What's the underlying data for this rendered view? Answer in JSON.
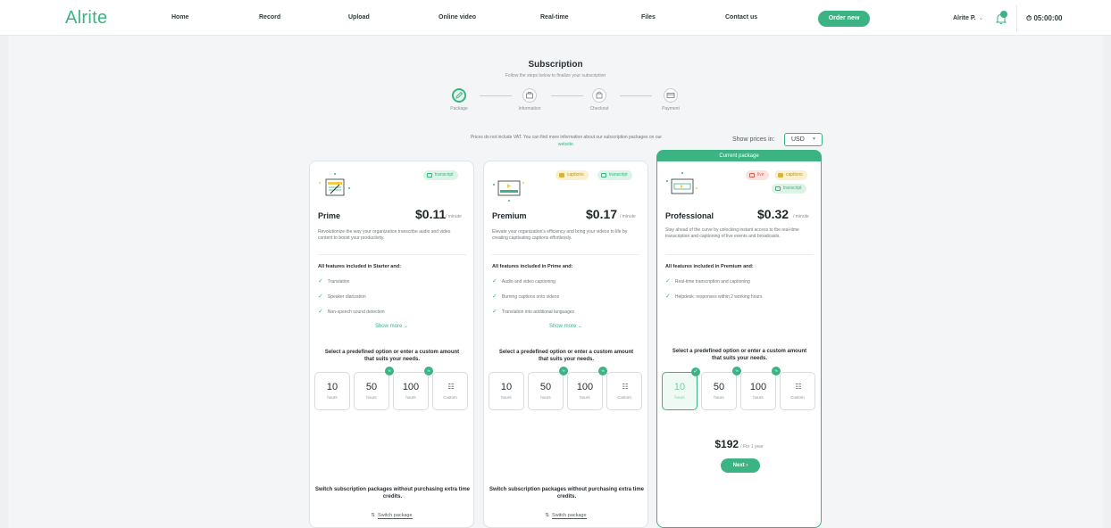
{
  "nav": {
    "logo": "Alrite",
    "links": [
      "Home",
      "Record",
      "Upload",
      "Online video",
      "Real-time",
      "Files",
      "Contact us"
    ],
    "order_button": "Order new",
    "user": "Alrite P.",
    "timer": "05:00:00",
    "icons": {
      "user_menu": "chevron-down-icon",
      "notifications": "bell-icon",
      "timer": "stopwatch-icon"
    }
  },
  "subscription": {
    "title": "Subscription",
    "subtitle": "Follow the steps below to finalize your subscription",
    "steps": [
      "Package",
      "Information",
      "Checkout",
      "Payment"
    ],
    "step_icons": [
      "pencil-icon",
      "briefcase-icon",
      "bag-icon",
      "card-icon"
    ],
    "current_step": 0
  },
  "pricing_note": {
    "text": "Prices do not include VAT. You can find more information about our subscription packages on our",
    "link": "website."
  },
  "currency": {
    "label": "Show prices in:",
    "value": "USD"
  },
  "packages": [
    {
      "name": "Prime",
      "price": "$0.11",
      "unit": "/ minute",
      "badges": [
        "transcript"
      ],
      "description": "Revolutionize the way your organization transcribe audio and video content to boost your productivity.",
      "features_head": "All features included in Starter and:",
      "features": [
        "Translation",
        "Speaker diarization",
        "Non-speech sound detection"
      ],
      "show_more": "Show more",
      "select_text": "Select a predefined option or enter a custom amount that suits your needs.",
      "options": [
        {
          "value": "10",
          "label": "hours"
        },
        {
          "value": "50",
          "label": "hours"
        },
        {
          "value": "100",
          "label": "hours"
        },
        {
          "value": "",
          "label": "Custom"
        }
      ],
      "switch_text": "Switch subscription packages without purchasing extra time credits.",
      "switch_link": "Switch package"
    },
    {
      "name": "Premium",
      "price": "$0.17",
      "unit": "/ minute",
      "badges": [
        "captions",
        "transcript"
      ],
      "description": "Elevate your organization's efficiency and bring your videos to life by creating captivating captions effortlessly.",
      "features_head": "All features included in Prime and:",
      "features": [
        "Audio and video captioning",
        "Burning captions onto videos",
        "Translation into additional languages"
      ],
      "show_more": "Show more",
      "select_text": "Select a predefined option or enter a custom amount that suits your needs.",
      "options": [
        {
          "value": "10",
          "label": "hours"
        },
        {
          "value": "50",
          "label": "hours"
        },
        {
          "value": "100",
          "label": "hours"
        },
        {
          "value": "",
          "label": "Custom"
        }
      ],
      "switch_text": "Switch subscription packages without purchasing extra time credits.",
      "switch_link": "Switch package"
    },
    {
      "name": "Professional",
      "current_label": "Current package",
      "price": "$0.32",
      "unit": "/ minute",
      "badges": [
        "live",
        "captions",
        "transcript"
      ],
      "description": "Stay ahead of the curve by unlocking instant access to the real-time transcription and captioning of live events and broadcasts.",
      "features_head": "All features included in Premium and:",
      "features": [
        "Real-time transcription and captioning",
        "Helpdesk: responses within 2 working hours"
      ],
      "select_text": "Select a predefined option or enter a custom amount that suits your needs.",
      "options": [
        {
          "value": "10",
          "label": "hours"
        },
        {
          "value": "50",
          "label": "hours"
        },
        {
          "value": "100",
          "label": "hours"
        },
        {
          "value": "",
          "label": "Custom"
        }
      ],
      "selected_option": 0,
      "total": "$192",
      "total_period": "/ For 1 year",
      "next_button": "Next"
    }
  ],
  "colors": {
    "accent": "#3bb383",
    "captions": "#d8b43a",
    "live": "#df5c4b"
  }
}
